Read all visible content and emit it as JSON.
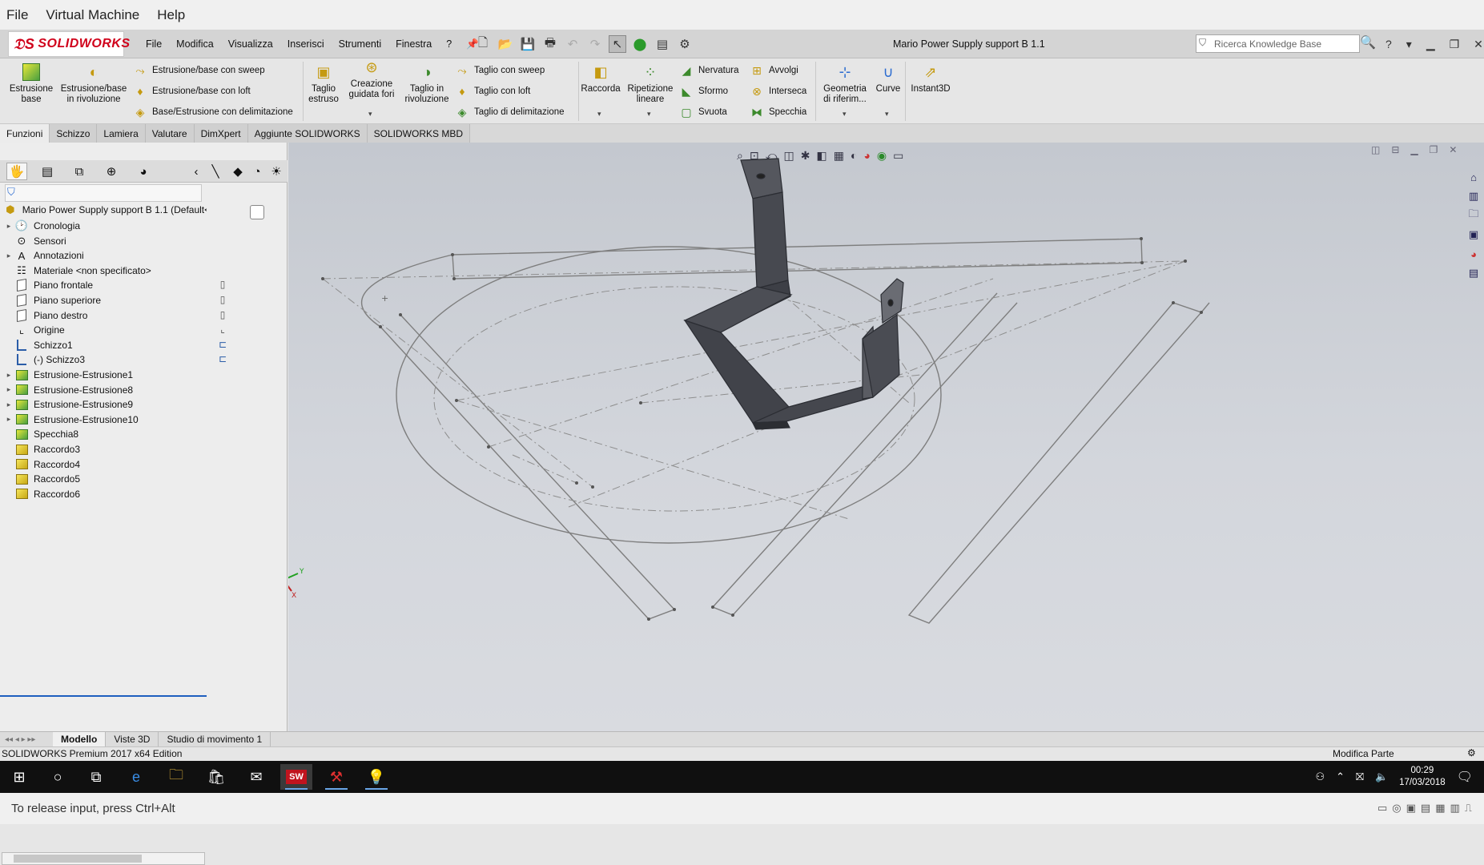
{
  "vm_menu": [
    "File",
    "Virtual Machine",
    "Help"
  ],
  "sw": {
    "logo": "SOLIDWORKS",
    "menus": [
      "File",
      "Modifica",
      "Visualizza",
      "Inserisci",
      "Strumenti",
      "Finestra",
      "?"
    ],
    "doc_title": "Mario Power Supply support B 1.1",
    "search_placeholder": "Ricerca Knowledge Base"
  },
  "ribbon": {
    "estrusione_base": [
      "Estrusione",
      "base"
    ],
    "estrusione_rivoluzione": [
      "Estrusione/base",
      "in rivoluzione"
    ],
    "sweep": "Estrusione/base con sweep",
    "loft": "Estrusione/base con loft",
    "delimitazione": "Base/Estrusione con delimitazione",
    "taglio_estruso": [
      "Taglio",
      "estruso"
    ],
    "creazione_fori": [
      "Creazione",
      "guidata fori"
    ],
    "taglio_rivoluzione": [
      "Taglio in",
      "rivoluzione"
    ],
    "taglio_sweep": "Taglio con sweep",
    "taglio_loft": "Taglio con loft",
    "taglio_delimitazione": "Taglio di delimitazione",
    "raccorda": "Raccorda",
    "ripetizione": [
      "Ripetizione",
      "lineare"
    ],
    "nervatura": "Nervatura",
    "sformo": "Sformo",
    "svuota": "Svuota",
    "avvolgi": "Avvolgi",
    "interseca": "Interseca",
    "specchia": "Specchia",
    "geometria": [
      "Geometria",
      "di riferim..."
    ],
    "curve": "Curve",
    "instant3d": "Instant3D"
  },
  "cmd_tabs": [
    "Funzioni",
    "Schizzo",
    "Lamiera",
    "Valutare",
    "DimXpert",
    "Aggiunte SOLIDWORKS",
    "SOLIDWORKS MBD"
  ],
  "tree": {
    "root": "Mario Power Supply support B 1.1  (Default<",
    "items": [
      {
        "label": "Cronologia",
        "icon": "history-icon",
        "exp": true
      },
      {
        "label": "Sensori",
        "icon": "sensor-icon",
        "exp": false
      },
      {
        "label": "Annotazioni",
        "icon": "annotation-icon",
        "exp": true
      },
      {
        "label": "Materiale <non specificato>",
        "icon": "material-icon",
        "exp": false
      },
      {
        "label": "Piano frontale",
        "icon": "plane-icon",
        "exp": false
      },
      {
        "label": "Piano superiore",
        "icon": "plane-icon",
        "exp": false
      },
      {
        "label": "Piano destro",
        "icon": "plane-icon",
        "exp": false
      },
      {
        "label": "Origine",
        "icon": "origin-icon",
        "exp": false
      },
      {
        "label": "Schizzo1",
        "icon": "sketch-icon",
        "exp": false
      },
      {
        "label": "(-) Schizzo3",
        "icon": "sketch-icon",
        "exp": false
      },
      {
        "label": "Estrusione-Estrusione1",
        "icon": "extrude-icon",
        "exp": true
      },
      {
        "label": "Estrusione-Estrusione8",
        "icon": "extrude-icon",
        "exp": true
      },
      {
        "label": "Estrusione-Estrusione9",
        "icon": "extrude-icon",
        "exp": true
      },
      {
        "label": "Estrusione-Estrusione10",
        "icon": "extrude-icon",
        "exp": true
      },
      {
        "label": "Specchia8",
        "icon": "mirror-icon",
        "exp": false
      },
      {
        "label": "Raccordo3",
        "icon": "fillet-icon",
        "exp": false
      },
      {
        "label": "Raccordo4",
        "icon": "fillet-icon",
        "exp": false
      },
      {
        "label": "Raccordo5",
        "icon": "fillet-icon",
        "exp": false
      },
      {
        "label": "Raccordo6",
        "icon": "fillet-icon",
        "exp": false
      }
    ]
  },
  "model_tabs": [
    "Modello",
    "Viste 3D",
    "Studio di movimento 1"
  ],
  "status": {
    "edition": "SOLIDWORKS Premium 2017 x64 Edition",
    "mode": "Modifica Parte"
  },
  "taskbar": {
    "time": "00:29",
    "date": "17/03/2018"
  },
  "vm_status": "To release input, press Ctrl+Alt",
  "colors": {
    "accent": "#d0021b",
    "selection": "#1f5fbf"
  }
}
